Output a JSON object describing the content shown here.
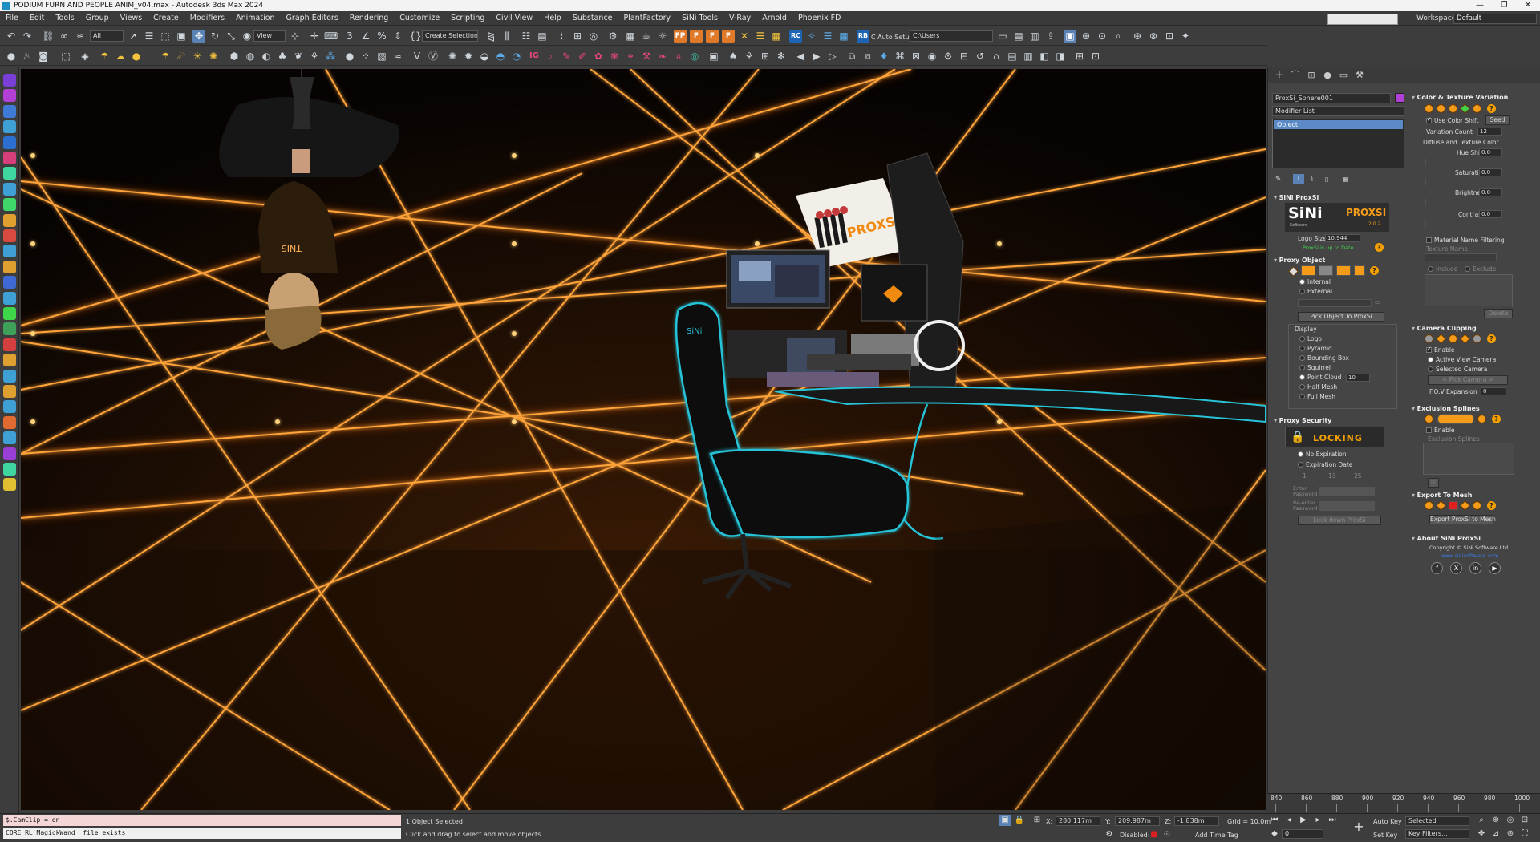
{
  "window": {
    "title": "PODIUM FURN AND PEOPLE ANIM_v04.max - Autodesk 3ds Max 2024"
  },
  "menu": [
    "File",
    "Edit",
    "Tools",
    "Group",
    "Views",
    "Create",
    "Modifiers",
    "Animation",
    "Graph Editors",
    "Rendering",
    "Customize",
    "Scripting",
    "Civil View",
    "Help",
    "Substance",
    "PlantFactory",
    "SiNi Tools",
    "V-Ray",
    "Arnold",
    "Phoenix FD"
  ],
  "workspace": {
    "label": "Workspaces:",
    "value": "Default"
  },
  "toolbar": {
    "selection_filter": "All",
    "ref_coord": "View",
    "selection_set": "Create Selection Se",
    "rb": "RB",
    "auto_setup": "C Auto Setup",
    "project_path": "C:\\Users",
    "icons_row1": [
      "undo-icon",
      "redo-icon",
      "link-icon",
      "unlink-icon",
      "bind-space-warp-icon",
      "select-object-icon",
      "select-by-name-icon",
      "rect-selection-icon",
      "window-crossing-icon",
      "select-move-icon",
      "select-rotate-icon",
      "select-scale-icon",
      "place-icon",
      "pivot-icon",
      "select-manipulate-icon",
      "keyboard-shortcut-icon",
      "snaps-icon",
      "angle-snap-icon",
      "percent-snap-icon",
      "spinner-snap-icon",
      "named-sets-icon",
      "mirror-icon",
      "align-icon",
      "layer-explorer-icon",
      "toggle-ribbon-icon",
      "curve-editor-icon",
      "schematic-view-icon",
      "material-editor-icon",
      "render-setup-icon",
      "rendered-frame-icon",
      "render-icon"
    ],
    "icons_row2": [
      "sphere-icon",
      "teapot-icon",
      "camera-icon",
      "light-icon",
      "helper-icon",
      "geometry-icon",
      "shape-icon",
      "particle-icon",
      "sun-icon",
      "plant-icon",
      "vray-icon",
      "phoenix-icon",
      "scatter-icon",
      "proxy-icon",
      "ig-icon",
      "paint-icon",
      "brush-icon"
    ]
  },
  "left_toolbar": {
    "icons": [
      "sini-icon-1",
      "sini-icon-2",
      "sini-icon-3",
      "sini-icon-4",
      "sini-icon-5",
      "sini-icon-6",
      "sini-icon-7",
      "sini-icon-8",
      "sini-icon-9",
      "sini-icon-10",
      "sini-icon-11",
      "sini-icon-12",
      "sini-icon-13",
      "sini-icon-14",
      "sini-icon-15",
      "sini-icon-16",
      "sini-icon-17",
      "sini-icon-18",
      "sini-icon-19",
      "sini-icon-20",
      "sini-icon-21",
      "sini-icon-22",
      "sini-icon-23",
      "sini-icon-24",
      "sini-icon-25",
      "sini-icon-26",
      "sini-icon-27"
    ]
  },
  "viewport": {
    "shirt_text": "TNIS",
    "poster_text": "PROXS",
    "desk_logo": "SiNi"
  },
  "command_panel": {
    "object_name": "ProxSi_Sphere001",
    "object_color": "#b23fd6",
    "modifier_list": "Modifier List",
    "stack_item": "Object",
    "sini_proxsi": {
      "title": "SiNi ProxSi",
      "logo_sini": "SiNi",
      "logo_software": "Software",
      "logo_proxsi": "PROXSI",
      "version": "2.0.2",
      "logo_size_label": "Logo Size:",
      "logo_size_value": "10.944",
      "up_to_date": "ProxSi is up to Date"
    },
    "proxy_object": {
      "title": "Proxy Object",
      "internal": "Internal",
      "external": "External",
      "pick_button": "Pick Object To ProxSi",
      "display_label": "Display",
      "display_options": [
        "Logo",
        "Pyramid",
        "Bounding Box",
        "Squirrel",
        "Point Cloud",
        "Half Mesh",
        "Full Mesh"
      ],
      "point_cloud_value": "10"
    },
    "proxy_security": {
      "title": "Proxy Security",
      "locking_label": "LOCKING",
      "no_expiration": "No Expiration",
      "expiration_date": "Expiration Date",
      "date_fields": [
        "1",
        "13",
        "25"
      ],
      "enter_password": "Enter Password",
      "reenter_password": "Re-enter Password",
      "lock_button": "Lock down ProxSi"
    },
    "color_texture": {
      "title": "Color & Texture Variation",
      "use_color_shift": "Use Color Shift",
      "seed": "Seed",
      "variation_count_label": "Variation Count",
      "variation_count_value": "12",
      "diffuse_label": "Diffuse and Texture Color",
      "hue_label": "Hue Shift",
      "hue_value": "0.0",
      "saturation_label": "Saturation",
      "saturation_value": "0.0",
      "brightness_label": "Brightness",
      "brightness_value": "0.0",
      "contrast_label": "Contrast",
      "contrast_value": "0.0",
      "material_filtering": "Material Name Filtering",
      "texture_name": "Texture Name",
      "include": "Include",
      "exclude": "Exclude",
      "delete": "Delete"
    },
    "camera_clipping": {
      "title": "Camera Clipping",
      "enable": "Enable",
      "active_view": "Active View Camera",
      "selected_camera": "Selected Camera",
      "pick_camera": "< Pick Camera >",
      "fov_label": "F.O.V Expansion",
      "fov_value": "0"
    },
    "exclusion_splines": {
      "title": "Exclusion Splines",
      "enable": "Enable",
      "list_label": "Exclusion Splines"
    },
    "export_mesh": {
      "title": "Export To Mesh",
      "button": "Export ProxSi to Mesh"
    },
    "about": {
      "title": "About SiNi ProxSi",
      "copyright": "Copyright © SiNi Software Ltd",
      "website": "www.sinisoftware.com",
      "socials": [
        "f",
        "X",
        "in",
        "▶"
      ]
    }
  },
  "timeline": {
    "ticks": [
      "840",
      "860",
      "880",
      "900",
      "920",
      "940",
      "960",
      "980",
      "1000"
    ]
  },
  "status": {
    "maxscript_line1": "$.CamClip = on",
    "maxscript_line2": "CORE_RL_MagickWand_ file exists",
    "selected": "1 Object Selected",
    "prompt": "Click and drag to select and move objects",
    "x_label": "X:",
    "x_value": "280.117m",
    "y_label": "Y:",
    "y_value": "209.987m",
    "z_label": "Z:",
    "z_value": "-1.838m",
    "grid": "Grid = 10.0m",
    "disabled_label": "Disabled:",
    "add_time_tag": "Add Time Tag",
    "auto_key": "Auto Key",
    "set_key": "Set Key",
    "key_mode": "Selected",
    "key_filters": "Key Filters...",
    "frame": "0"
  }
}
